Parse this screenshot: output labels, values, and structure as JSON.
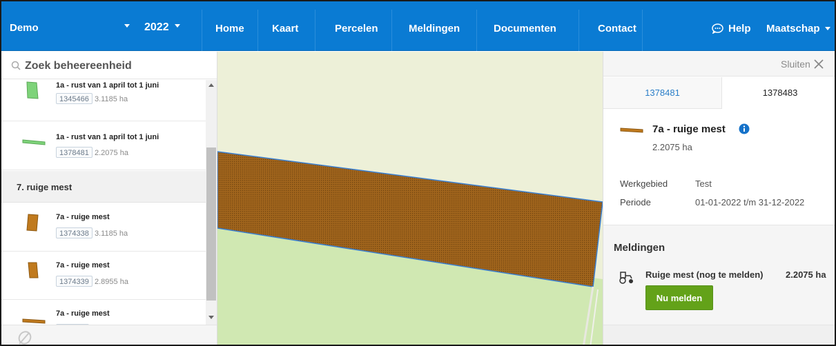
{
  "navbar": {
    "brand": "Demo",
    "year": "2022",
    "links": [
      "Home",
      "Kaart",
      "Percelen",
      "Meldingen",
      "Documenten",
      "Contact"
    ],
    "help": "Help",
    "account": "Maatschap"
  },
  "sidebar": {
    "search_placeholder": "Zoek beheereenheid",
    "items": [
      {
        "title": "1a - rust van 1 april tot 1 juni",
        "id": "1345466",
        "area": "3.1185 ha",
        "color": "#7ed37a"
      },
      {
        "title": "1a - rust van 1 april tot 1 juni",
        "id": "1378481",
        "area": "2.2075 ha",
        "color": "#7ed37a"
      },
      {
        "title": "7a - ruige mest",
        "id": "1374338",
        "area": "3.1185 ha",
        "color": "#c07a1e"
      },
      {
        "title": "7a - ruige mest",
        "id": "1374339",
        "area": "2.8955 ha",
        "color": "#c07a1e"
      },
      {
        "title": "7a - ruige mest",
        "id": "",
        "area": "",
        "color": "#c07a1e"
      }
    ],
    "group_header": "7. ruige mest"
  },
  "panel": {
    "close_label": "Sluiten",
    "tabs": [
      "1378481",
      "1378483"
    ],
    "detail": {
      "title": "7a - ruige mest",
      "area": "2.2075 ha",
      "color": "#c07a1e"
    },
    "properties": [
      {
        "label": "Werkgebied",
        "value": "Test"
      },
      {
        "label": "Periode",
        "value": "01-01-2022 t/m 31-12-2022"
      }
    ],
    "meldingen": {
      "title": "Meldingen",
      "text": "Ruige mest (nog te melden)",
      "area": "2.2075 ha",
      "button": "Nu melden"
    }
  },
  "colors": {
    "nav": "#0a7bd3",
    "map_pale": "#edf0d8",
    "map_green": "#d0e8b2",
    "parcel": "#a0641c",
    "parcel_outline": "#3a7fd0",
    "button": "#63a219",
    "link": "#2a7ec8"
  }
}
